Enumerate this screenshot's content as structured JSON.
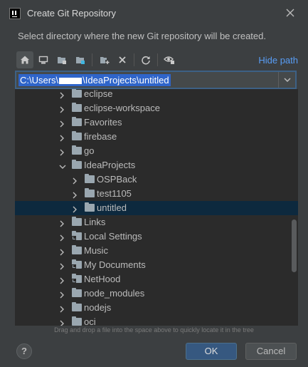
{
  "dialog": {
    "title": "Create Git Repository",
    "subtitle": "Select directory where the new Git repository will be created.",
    "hide_path": "Hide path",
    "path_before": "C:\\Users\\",
    "path_after": "\\IdeaProjects\\untitled",
    "hint": "Drag and drop a file into the space above to quickly locate it in the tree",
    "help": "?",
    "ok": "OK",
    "cancel": "Cancel"
  },
  "toolbar": {
    "icons": [
      "home-icon",
      "desktop-icon",
      "project-icon",
      "module-icon",
      "new-folder-icon",
      "delete-icon",
      "refresh-icon",
      "show-hidden-icon"
    ]
  },
  "tree": {
    "rows": [
      {
        "label": "eclipse",
        "expanded": false,
        "link": false
      },
      {
        "label": "eclipse-workspace",
        "expanded": false,
        "link": false
      },
      {
        "label": "Favorites",
        "expanded": false,
        "link": false
      },
      {
        "label": "firebase",
        "expanded": false,
        "link": false
      },
      {
        "label": "go",
        "expanded": false,
        "link": false
      },
      {
        "label": "IdeaProjects",
        "expanded": true,
        "link": false
      },
      {
        "label": "OSPBack",
        "expanded": false,
        "link": false
      },
      {
        "label": "test1105",
        "expanded": false,
        "link": false
      },
      {
        "label": "untitled",
        "expanded": false,
        "link": false,
        "selected": true
      },
      {
        "label": "Links",
        "expanded": false,
        "link": false
      },
      {
        "label": "Local Settings",
        "expanded": false,
        "link": true
      },
      {
        "label": "Music",
        "expanded": false,
        "link": false
      },
      {
        "label": "My Documents",
        "expanded": false,
        "link": true
      },
      {
        "label": "NetHood",
        "expanded": false,
        "link": true
      },
      {
        "label": "node_modules",
        "expanded": false,
        "link": false
      },
      {
        "label": "nodejs",
        "expanded": false,
        "link": false
      },
      {
        "label": "oci",
        "expanded": false,
        "link": false
      }
    ]
  },
  "colors": {
    "background": "#3c3f41",
    "tree_background": "#2b2b2b",
    "selection": "#0d293e",
    "accent": "#589df6",
    "ok_button": "#365880"
  }
}
